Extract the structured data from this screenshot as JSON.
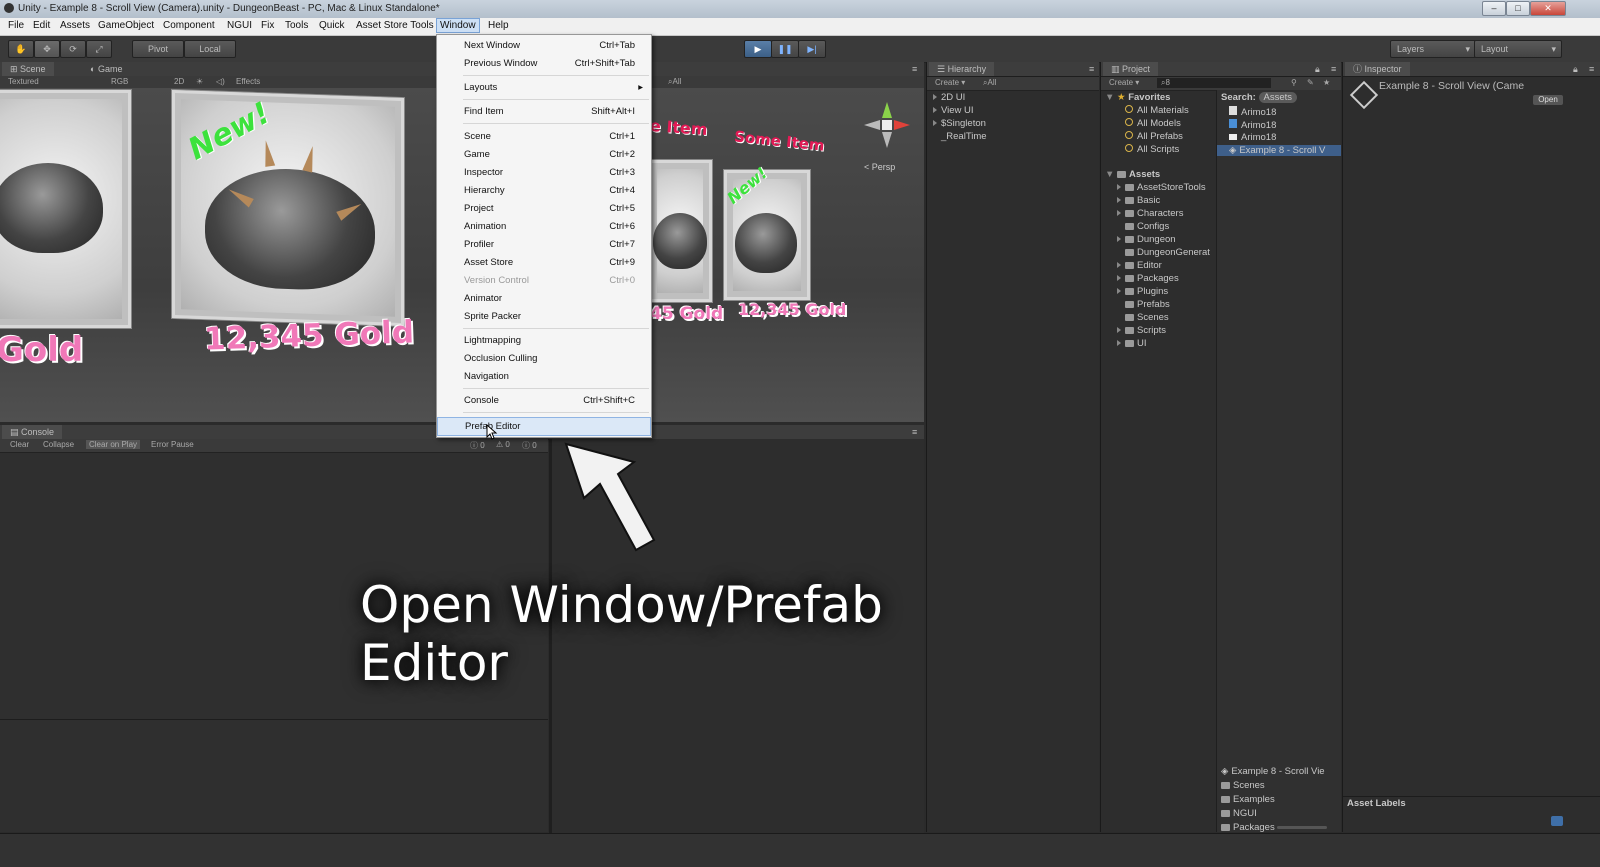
{
  "window": {
    "title": "Unity - Example 8 - Scroll View (Camera).unity - DungeonBeast - PC, Mac & Linux Standalone*"
  },
  "menubar": [
    "File",
    "Edit",
    "Assets",
    "GameObject",
    "Component",
    "NGUI",
    "Fix",
    "Tools",
    "Quick",
    "Asset Store Tools",
    "Window",
    "Help"
  ],
  "toolbar": {
    "pivot": "Pivot",
    "local": "Local",
    "layers": "Layers",
    "layout": "Layout"
  },
  "scene_panel": {
    "tabs": [
      "Scene",
      "Game"
    ],
    "sub": {
      "shading": "Textured",
      "rgb": "RGB",
      "mode2d": "2D",
      "effects": "Effects",
      "search": "All"
    },
    "persp": "Persp",
    "cards": {
      "new_label": "New!",
      "gold_label": "12,345 Gold",
      "gold_small": "12,345 Gold",
      "gold_partial_left": "Gold",
      "gold_partial_mid": "45 Gold",
      "item_partial": "e Item",
      "item_label": "Some Item"
    }
  },
  "console": {
    "tab": "Console",
    "buttons": [
      "Clear",
      "Collapse",
      "Clear on Play",
      "Error Pause"
    ],
    "counts": [
      "0",
      "0",
      "0"
    ]
  },
  "window_menu": {
    "groups": [
      [
        {
          "label": "Next Window",
          "shortcut": "Ctrl+Tab"
        },
        {
          "label": "Previous Window",
          "shortcut": "Ctrl+Shift+Tab"
        }
      ],
      [
        {
          "label": "Layouts",
          "shortcut": ""
        }
      ],
      [
        {
          "label": "Find Item",
          "shortcut": "Shift+Alt+I"
        }
      ],
      [
        {
          "label": "Scene",
          "shortcut": "Ctrl+1"
        },
        {
          "label": "Game",
          "shortcut": "Ctrl+2"
        },
        {
          "label": "Inspector",
          "shortcut": "Ctrl+3"
        },
        {
          "label": "Hierarchy",
          "shortcut": "Ctrl+4"
        },
        {
          "label": "Project",
          "shortcut": "Ctrl+5"
        },
        {
          "label": "Animation",
          "shortcut": "Ctrl+6"
        },
        {
          "label": "Profiler",
          "shortcut": "Ctrl+7"
        },
        {
          "label": "Asset Store",
          "shortcut": "Ctrl+9"
        },
        {
          "label": "Version Control",
          "shortcut": "Ctrl+0",
          "disabled": true
        },
        {
          "label": "Animator",
          "shortcut": ""
        },
        {
          "label": "Sprite Packer",
          "shortcut": ""
        }
      ],
      [
        {
          "label": "Lightmapping",
          "shortcut": ""
        },
        {
          "label": "Occlusion Culling",
          "shortcut": ""
        },
        {
          "label": "Navigation",
          "shortcut": ""
        }
      ],
      [
        {
          "label": "Console",
          "shortcut": "Ctrl+Shift+C"
        }
      ],
      [
        {
          "label": "Prefab Editor",
          "shortcut": "",
          "highlighted": true
        }
      ]
    ]
  },
  "hierarchy": {
    "tab": "Hierarchy",
    "create": "Create",
    "search": "All",
    "items": [
      "2D UI",
      "View UI",
      "$Singleton",
      "_RealTime"
    ]
  },
  "project": {
    "tab": "Project",
    "create": "Create",
    "search_value": "8",
    "favorites_header": "Favorites",
    "favorites": [
      "All Materials",
      "All Models",
      "All Prefabs",
      "All Scripts"
    ],
    "assets_header": "Assets",
    "folders": [
      "AssetStoreTools",
      "Basic",
      "Characters",
      "Configs",
      "Dungeon",
      "DungeonGenerat",
      "Editor",
      "Packages",
      "Plugins",
      "Prefabs",
      "Scenes",
      "Scripts",
      "UI"
    ],
    "search_label": "Search:",
    "search_scope": "Assets",
    "results": [
      "Arimo18",
      "Arimo18",
      "Arimo18",
      "Example 8 - Scroll V"
    ],
    "bottom_items": [
      "Example 8 - Scroll Vie",
      "Scenes",
      "Examples",
      "NGUI",
      "Packages"
    ]
  },
  "inspector": {
    "tab": "Inspector",
    "object": "Example 8 - Scroll View (Came",
    "open": "Open",
    "asset_labels": "Asset Labels"
  },
  "caption": "Open Window/Prefab Editor"
}
